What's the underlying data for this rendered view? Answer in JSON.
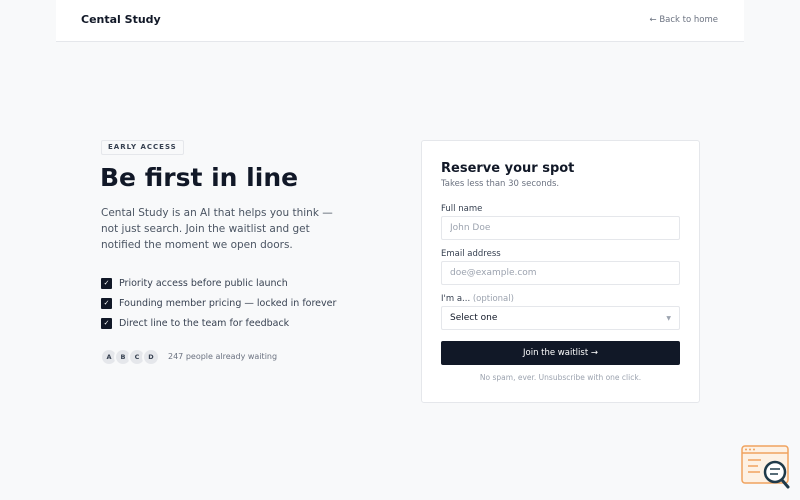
{
  "header": {
    "brand": "Cental Study",
    "back_link": "← Back to home"
  },
  "hero": {
    "badge": "EARLY ACCESS",
    "headline": "Be first in line",
    "intro": "Cental Study is an AI that helps you think — not just search. Join the waitlist and get notified the moment we open doors.",
    "features": [
      "Priority access before public launch",
      "Founding member pricing — locked in forever",
      "Direct line to the team for feedback"
    ],
    "avatars": [
      "A",
      "B",
      "C",
      "D"
    ],
    "waiting_text": "247 people already waiting"
  },
  "form": {
    "title": "Reserve your spot",
    "subtitle": "Takes less than 30 seconds.",
    "name_label": "Full name",
    "name_placeholder": "John Doe",
    "email_label": "Email address",
    "email_placeholder": "doe@example.com",
    "role_label": "I'm a...",
    "role_optional": "(optional)",
    "role_value": "Select one",
    "submit_label": "Join the waitlist →",
    "disclaimer": "No spam, ever. Unsubscribe with one click."
  },
  "icons": {
    "check": "check-icon",
    "chevron": "chevron-down-icon",
    "widget": "search-help-icon"
  },
  "colors": {
    "dark": "#111827",
    "muted": "#6b7280",
    "border": "#e5e7eb",
    "background": "#f8f9fa",
    "widget_accent": "#f0a35e",
    "widget_dark": "#1f3a4a"
  }
}
